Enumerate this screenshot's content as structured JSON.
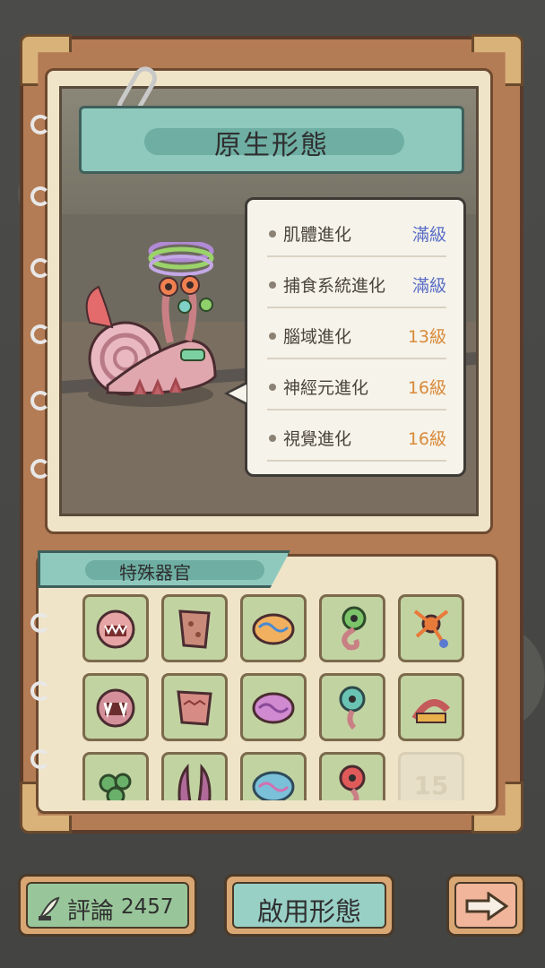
{
  "form_title": "原生形態",
  "stats": [
    {
      "name": "肌體進化",
      "level": "滿級",
      "color": "#5b6fc7"
    },
    {
      "name": "捕食系統進化",
      "level": "滿級",
      "color": "#5b6fc7"
    },
    {
      "name": "腦域進化",
      "level": "13級",
      "color": "#d98a3a"
    },
    {
      "name": "神經元進化",
      "level": "16級",
      "color": "#d98a3a"
    },
    {
      "name": "視覺進化",
      "level": "16級",
      "color": "#d98a3a"
    }
  ],
  "special_organs": {
    "title": "特殊器官",
    "items": [
      {
        "icon": "jaw-organ-icon"
      },
      {
        "icon": "skin-organ-icon"
      },
      {
        "icon": "brain-organ-icon"
      },
      {
        "icon": "eye-stalk-organ-icon"
      },
      {
        "icon": "neuron-organ-icon"
      },
      {
        "icon": "fanged-jaw-organ-icon"
      },
      {
        "icon": "flesh-organ-icon"
      },
      {
        "icon": "pink-brain-organ-icon"
      },
      {
        "icon": "teal-eye-organ-icon"
      },
      {
        "icon": "spring-organ-icon"
      },
      {
        "icon": "tentacle-cluster-icon"
      },
      {
        "icon": "horns-organ-icon"
      },
      {
        "icon": "blue-brain-organ-icon"
      },
      {
        "icon": "red-eye-organ-icon"
      },
      {
        "icon": "locked-slot",
        "label": "15"
      }
    ]
  },
  "buttons": {
    "review_label": "評論",
    "review_count": "2457",
    "enable_label": "啟用形態",
    "next_icon": "arrow-right-icon"
  }
}
